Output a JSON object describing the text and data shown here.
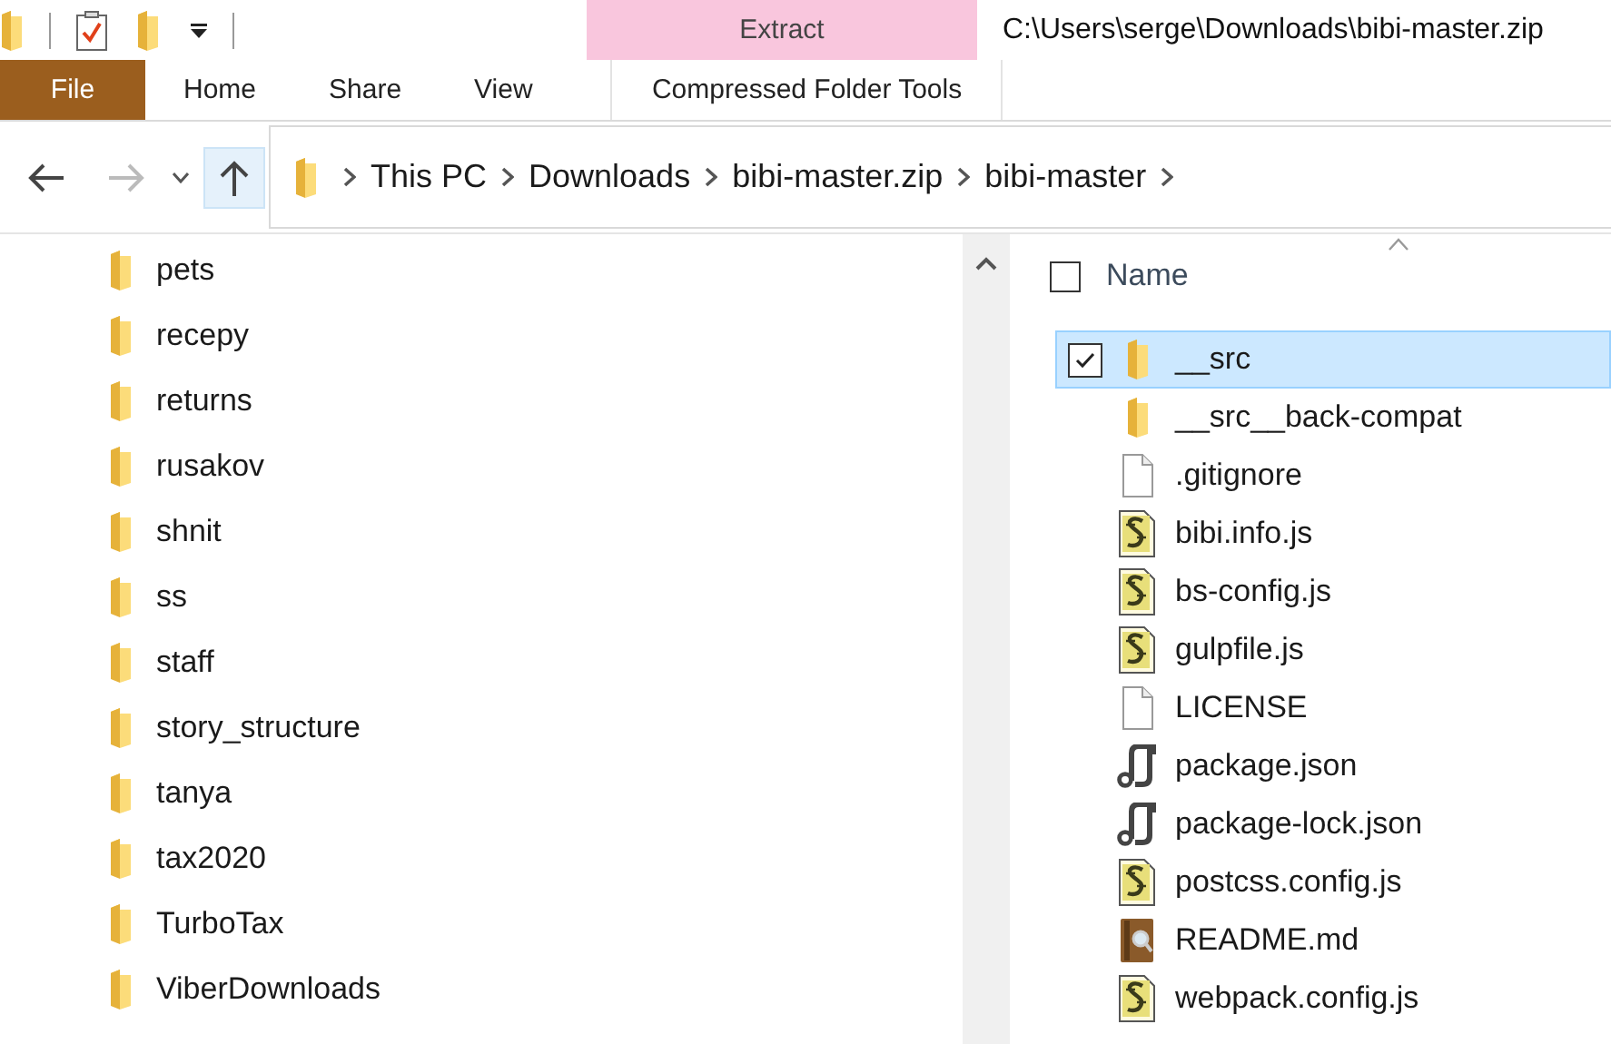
{
  "title_bar": {
    "context_group": "Extract",
    "path": "C:\\Users\\serge\\Downloads\\bibi-master.zip"
  },
  "ribbon_tabs": [
    {
      "label": "File",
      "kind": "file",
      "selected": false
    },
    {
      "label": "Home",
      "kind": "tab",
      "selected": false
    },
    {
      "label": "Share",
      "kind": "tab",
      "selected": false
    },
    {
      "label": "View",
      "kind": "tab",
      "selected": false
    },
    {
      "label": "Compressed Folder Tools",
      "kind": "context",
      "selected": false
    }
  ],
  "address_bar": {
    "breadcrumbs": [
      "This PC",
      "Downloads",
      "bibi-master.zip",
      "bibi-master"
    ]
  },
  "nav_pane": {
    "items": [
      "pets",
      "recepy",
      "returns",
      "rusakov",
      "shnit",
      "ss",
      "staff",
      "story_structure",
      "tanya",
      "tax2020",
      "TurboTax",
      "ViberDownloads"
    ]
  },
  "file_list": {
    "column": "Name",
    "select_all_checked": false,
    "rows": [
      {
        "name": "__src",
        "kind": "folder",
        "selected": true
      },
      {
        "name": "__src__back-compat",
        "kind": "folder",
        "selected": false
      },
      {
        "name": ".gitignore",
        "kind": "file",
        "selected": false
      },
      {
        "name": "bibi.info.js",
        "kind": "script",
        "selected": false
      },
      {
        "name": "bs-config.js",
        "kind": "script",
        "selected": false
      },
      {
        "name": "gulpfile.js",
        "kind": "script",
        "selected": false
      },
      {
        "name": "LICENSE",
        "kind": "file",
        "selected": false
      },
      {
        "name": "package.json",
        "kind": "package",
        "selected": false
      },
      {
        "name": "package-lock.json",
        "kind": "package",
        "selected": false
      },
      {
        "name": "postcss.config.js",
        "kind": "script",
        "selected": false
      },
      {
        "name": "README.md",
        "kind": "readme",
        "selected": false
      },
      {
        "name": "webpack.config.js",
        "kind": "script",
        "selected": false
      }
    ]
  }
}
